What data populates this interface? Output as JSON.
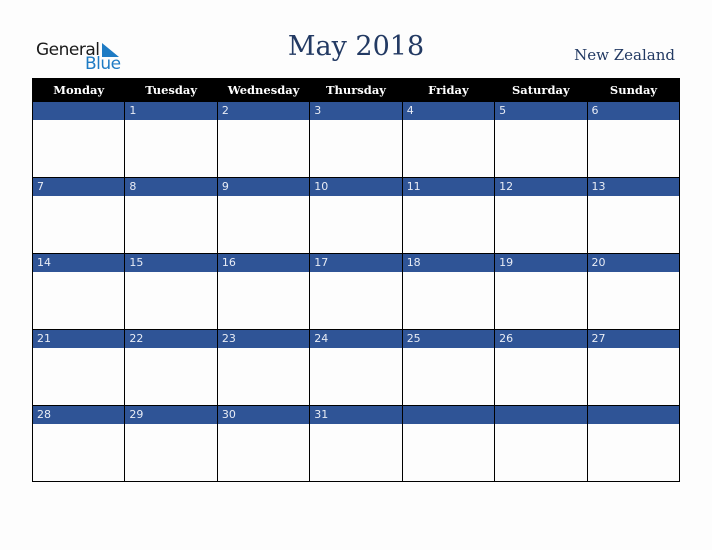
{
  "logo": {
    "word1": "General",
    "word2": "Blue",
    "icon": "triangle-flag-icon",
    "colors": {
      "text": "#1a1a1a",
      "accent": "#1e7bc4"
    }
  },
  "header": {
    "title": "May 2018",
    "country": "New Zealand"
  },
  "colors": {
    "header_bg": "#000000",
    "band": "#2f5496",
    "title": "#233a63"
  },
  "calendar": {
    "weekdays": [
      "Monday",
      "Tuesday",
      "Wednesday",
      "Thursday",
      "Friday",
      "Saturday",
      "Sunday"
    ],
    "weeks": [
      [
        "",
        "1",
        "2",
        "3",
        "4",
        "5",
        "6"
      ],
      [
        "7",
        "8",
        "9",
        "10",
        "11",
        "12",
        "13"
      ],
      [
        "14",
        "15",
        "16",
        "17",
        "18",
        "19",
        "20"
      ],
      [
        "21",
        "22",
        "23",
        "24",
        "25",
        "26",
        "27"
      ],
      [
        "28",
        "29",
        "30",
        "31",
        "",
        "",
        ""
      ]
    ]
  }
}
